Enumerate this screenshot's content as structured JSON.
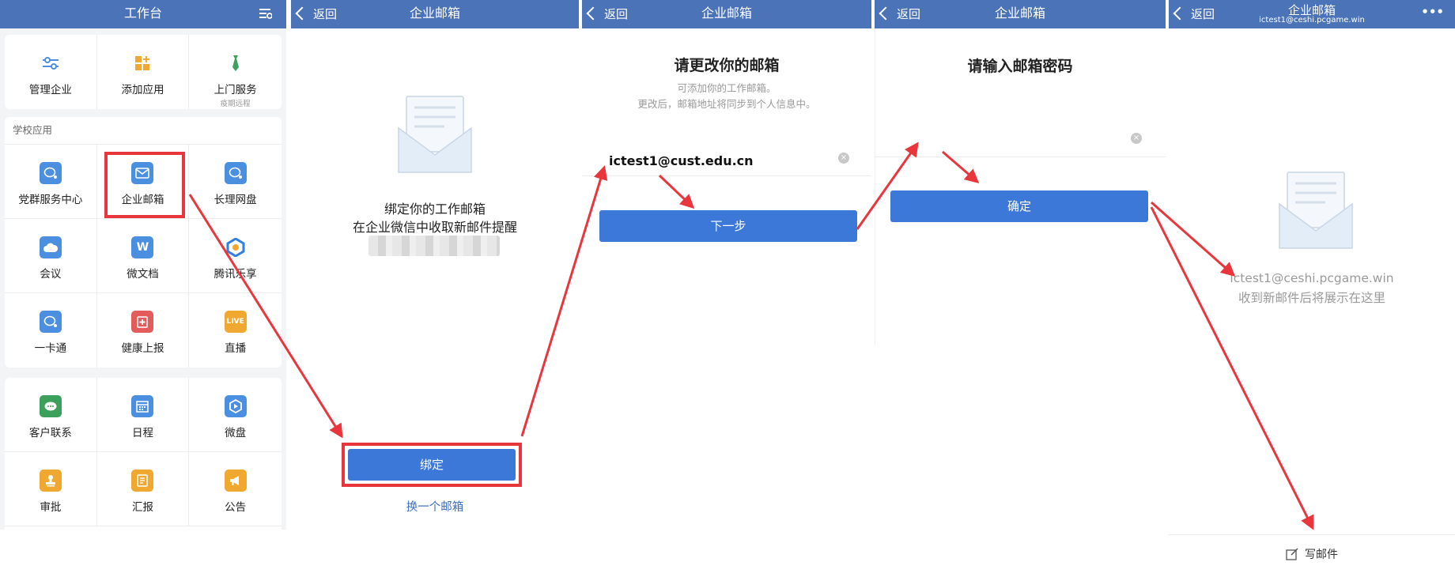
{
  "panel1": {
    "title": "工作台",
    "top_items": [
      {
        "label": "管理企业",
        "icon": "sliders-icon",
        "sub": ""
      },
      {
        "label": "添加应用",
        "icon": "add-app-icon",
        "sub": ""
      },
      {
        "label": "上门服务",
        "icon": "tie-icon",
        "sub": "疫期远程"
      }
    ],
    "school_section_title": "学校应用",
    "school_items": [
      {
        "label": "党群服务中心",
        "icon": "chat-bubble-icon"
      },
      {
        "label": "企业邮箱",
        "icon": "mail-icon"
      },
      {
        "label": "长理网盘",
        "icon": "chat-bubble-icon"
      },
      {
        "label": "会议",
        "icon": "cloud-icon"
      },
      {
        "label": "微文档",
        "icon": "w-doc-icon",
        "glyph": "W"
      },
      {
        "label": "腾讯乐享",
        "icon": "lexiang-icon"
      },
      {
        "label": "一卡通",
        "icon": "chat-bubble-icon"
      },
      {
        "label": "健康上报",
        "icon": "health-report-icon"
      },
      {
        "label": "直播",
        "icon": "live-icon",
        "glyph": "LIVE"
      }
    ],
    "more_items": [
      {
        "label": "客户联系",
        "icon": "wechat-icon"
      },
      {
        "label": "日程",
        "icon": "calendar-icon"
      },
      {
        "label": "微盘",
        "icon": "drive-icon"
      },
      {
        "label": "审批",
        "icon": "stamp-icon"
      },
      {
        "label": "汇报",
        "icon": "report-icon"
      },
      {
        "label": "公告",
        "icon": "megaphone-icon"
      }
    ],
    "colors": {
      "blue": "#4a8fe0",
      "orange": "#f0a830",
      "green": "#3aa05a",
      "red": "#e45b5b"
    }
  },
  "panel2": {
    "back": "返回",
    "title": "企业邮箱",
    "bind_heading": "绑定你的工作邮箱",
    "bind_subtitle": "在企业微信中收取新邮件提醒",
    "bind_button": "绑定",
    "switch_link": "换一个邮箱"
  },
  "panel3": {
    "back": "返回",
    "title": "企业邮箱",
    "heading": "请更改你的邮箱",
    "hint1": "可添加你的工作邮箱。",
    "hint2": "更改后，邮箱地址将同步到个人信息中。",
    "email_value": "ictest1@cust.edu.cn",
    "next_button": "下一步"
  },
  "panel4": {
    "back": "返回",
    "title": "企业邮箱",
    "heading": "请输入邮箱密码",
    "password_value": "",
    "confirm_button": "确定"
  },
  "panel5": {
    "back": "返回",
    "title": "企业邮箱",
    "subtitle": "ictest1@ceshi.pcgame.win",
    "more": "•••",
    "empty_email": "ictest1@ceshi.pcgame.win",
    "empty_hint": "收到新邮件后将展示在这里",
    "compose": "写邮件"
  },
  "accent": {
    "topbar": "#4a73b8",
    "button": "#3c78d8",
    "annotation": "#e8363c"
  }
}
